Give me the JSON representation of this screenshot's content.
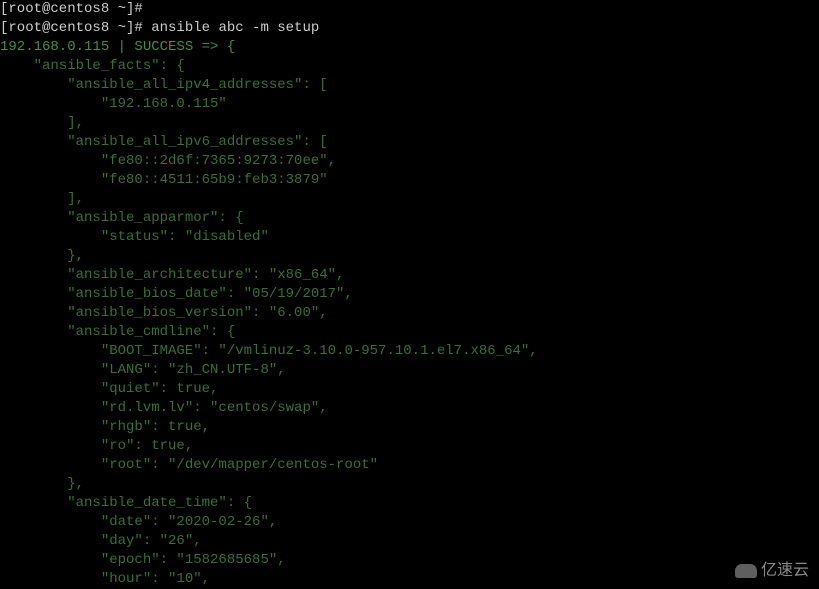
{
  "prompt1": "[root@centos8 ~]#",
  "prompt2": "[root@centos8 ~]#",
  "command": " ansible abc -m setup",
  "result_host": "192.168.0.115",
  "result_status": " | SUCCESS => ",
  "open_brace": "{",
  "lines": [
    "    \"ansible_facts\": {",
    "        \"ansible_all_ipv4_addresses\": [",
    "            \"192.168.0.115\"",
    "        ],",
    "        \"ansible_all_ipv6_addresses\": [",
    "            \"fe80::2d6f:7365:9273:70ee\",",
    "            \"fe80::4511:65b9:feb3:3879\"",
    "        ],",
    "        \"ansible_apparmor\": {",
    "            \"status\": \"disabled\"",
    "        },",
    "        \"ansible_architecture\": \"x86_64\",",
    "        \"ansible_bios_date\": \"05/19/2017\",",
    "        \"ansible_bios_version\": \"6.00\",",
    "        \"ansible_cmdline\": {",
    "            \"BOOT_IMAGE\": \"/vmlinuz-3.10.0-957.10.1.el7.x86_64\",",
    "            \"LANG\": \"zh_CN.UTF-8\",",
    "            \"quiet\": true,",
    "            \"rd.lvm.lv\": \"centos/swap\",",
    "            \"rhgb\": true,",
    "            \"ro\": true,",
    "            \"root\": \"/dev/mapper/centos-root\"",
    "        },",
    "        \"ansible_date_time\": {",
    "            \"date\": \"2020-02-26\",",
    "            \"day\": \"26\",",
    "            \"epoch\": \"1582685685\",",
    "            \"hour\": \"10\","
  ],
  "watermark_text": "亿速云",
  "chart_data": {
    "type": "table",
    "title": "Ansible setup module output (gathered facts)",
    "facts": {
      "ansible_all_ipv4_addresses": [
        "192.168.0.115"
      ],
      "ansible_all_ipv6_addresses": [
        "fe80::2d6f:7365:9273:70ee",
        "fe80::4511:65b9:feb3:3879"
      ],
      "ansible_apparmor": {
        "status": "disabled"
      },
      "ansible_architecture": "x86_64",
      "ansible_bios_date": "05/19/2017",
      "ansible_bios_version": "6.00",
      "ansible_cmdline": {
        "BOOT_IMAGE": "/vmlinuz-3.10.0-957.10.1.el7.x86_64",
        "LANG": "zh_CN.UTF-8",
        "quiet": true,
        "rd.lvm.lv": "centos/swap",
        "rhgb": true,
        "ro": true,
        "root": "/dev/mapper/centos-root"
      },
      "ansible_date_time": {
        "date": "2020-02-26",
        "day": "26",
        "epoch": "1582685685",
        "hour": "10"
      }
    }
  }
}
